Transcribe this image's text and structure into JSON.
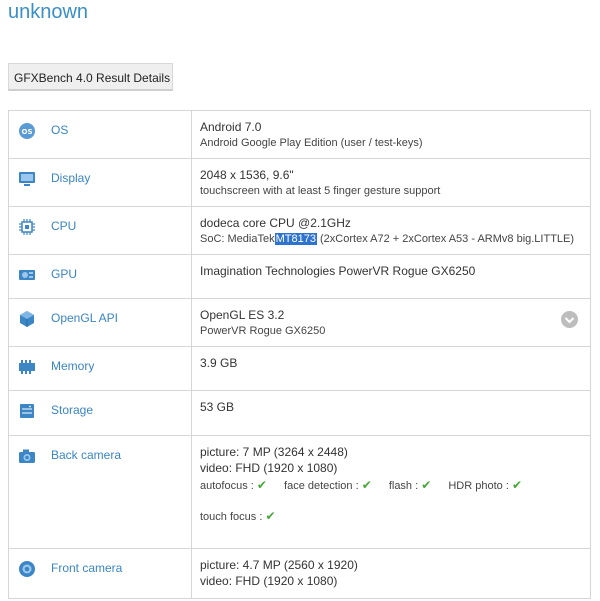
{
  "title": "unknown",
  "tab_label": "GFXBench 4.0 Result Details",
  "rows": {
    "os": {
      "label": "OS",
      "main": "Android 7.0",
      "sub": "Android Google Play Edition (user / test-keys)"
    },
    "display": {
      "label": "Display",
      "main": "2048 x 1536, 9.6\"",
      "sub": "touchscreen with at least 5 finger gesture support"
    },
    "cpu": {
      "label": "CPU",
      "main": "dodeca core CPU @2.1GHz",
      "sub_prefix": "SoC: MediaTek",
      "sub_highlight": "MT8173",
      "sub_suffix": "(2xCortex A72 + 2xCortex A53 - ARMv8 big.LITTLE)"
    },
    "gpu": {
      "label": "GPU",
      "main": "Imagination Technologies PowerVR Rogue GX6250"
    },
    "opengl": {
      "label": "OpenGL API",
      "main": "OpenGL ES 3.2",
      "sub": "PowerVR Rogue GX6250"
    },
    "memory": {
      "label": "Memory",
      "main": "3.9 GB"
    },
    "storage": {
      "label": "Storage",
      "main": "53 GB"
    },
    "back_camera": {
      "label": "Back camera",
      "picture": "picture: 7 MP (3264 x 2448)",
      "video": "video: FHD (1920 x 1080)",
      "features": [
        "autofocus :",
        "face detection :",
        "flash :",
        "HDR photo :"
      ],
      "touch_focus": "touch focus :"
    },
    "front_camera": {
      "label": "Front camera",
      "picture": "picture: 4.7 MP (2560 x 1920)",
      "video": "video: FHD (1920 x 1080)"
    }
  },
  "colors": {
    "accent": "#3a85c4",
    "highlight": "#2f73d0",
    "check": "#43a838"
  }
}
